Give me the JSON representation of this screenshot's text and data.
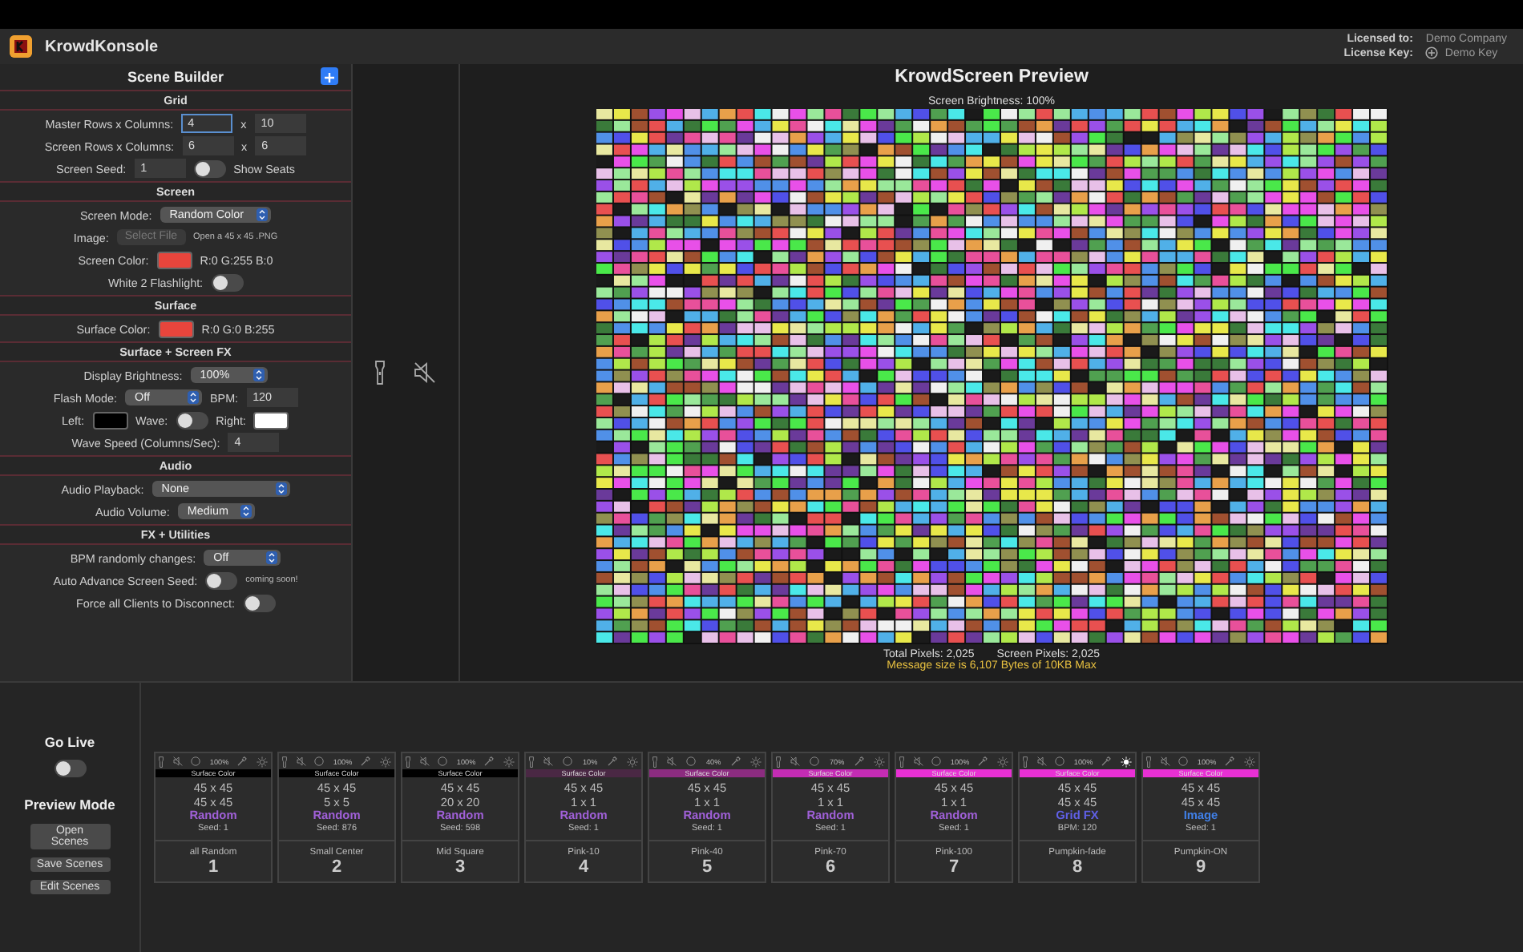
{
  "app": {
    "title": "KrowdKonsole",
    "licensed_label": "Licensed to:",
    "licensed_value": "Demo Company",
    "key_label": "License Key:",
    "key_value": "Demo Key"
  },
  "builder": {
    "title": "Scene Builder",
    "sections": [
      {
        "title": "Grid",
        "rows": [
          {
            "label": "Master Rows x Columns:",
            "items": [
              {
                "kind": "field",
                "value": "4",
                "focused": true
              },
              {
                "kind": "label",
                "text": "x"
              },
              {
                "kind": "field",
                "value": "10",
                "focused": false
              }
            ]
          },
          {
            "label": "Screen Rows x Columns:",
            "items": [
              {
                "kind": "field",
                "value": "6",
                "focused": false
              },
              {
                "kind": "label",
                "text": "x"
              },
              {
                "kind": "field",
                "value": "6",
                "focused": false
              }
            ]
          },
          {
            "label": "Screen Seed:",
            "items": [
              {
                "kind": "field",
                "value": "1",
                "focused": false
              },
              {
                "kind": "toggle",
                "on": false
              },
              {
                "kind": "label",
                "text": "Show Seats"
              }
            ]
          }
        ]
      },
      {
        "title": "Screen",
        "rows": [
          {
            "label": "Screen Mode:",
            "items": [
              {
                "kind": "select",
                "value": "Random Color"
              }
            ]
          },
          {
            "label": "Image:",
            "items": [
              {
                "kind": "button",
                "text": "Select File",
                "disabled": true
              },
              {
                "kind": "note",
                "text": "Open a 45 x 45 .PNG"
              }
            ]
          },
          {
            "label": "Screen Color:",
            "items": [
              {
                "kind": "swatch",
                "color": "#e8453c"
              },
              {
                "kind": "label",
                "text": "R:0 G:255 B:0"
              }
            ]
          },
          {
            "label": "White 2 Flashlight:",
            "items": [
              {
                "kind": "toggle",
                "on": false
              }
            ]
          }
        ]
      },
      {
        "title": "Surface",
        "rows": [
          {
            "label": "Surface Color:",
            "items": [
              {
                "kind": "swatch",
                "color": "#e8453c"
              },
              {
                "kind": "label",
                "text": "R:0 G:0 B:255"
              }
            ]
          }
        ]
      },
      {
        "title": "Surface + Screen FX",
        "rows": [
          {
            "label": "Display Brightness:",
            "items": [
              {
                "kind": "select",
                "value": "100%"
              }
            ]
          },
          {
            "label": "Flash Mode:",
            "items": [
              {
                "kind": "select",
                "value": "Off"
              },
              {
                "kind": "label",
                "text": "BPM:"
              },
              {
                "kind": "field",
                "value": "120",
                "focused": false
              }
            ]
          },
          {
            "label": "Left:",
            "items": [
              {
                "kind": "swatch",
                "color": "#000000"
              },
              {
                "kind": "label",
                "text": "Wave:"
              },
              {
                "kind": "toggle",
                "on": false
              },
              {
                "kind": "label",
                "text": "Right:"
              },
              {
                "kind": "swatch",
                "color": "#ffffff"
              }
            ]
          },
          {
            "label": "Wave Speed (Columns/Sec):",
            "items": [
              {
                "kind": "field",
                "value": "4",
                "focused": false
              }
            ]
          }
        ]
      },
      {
        "title": "Audio",
        "rows": [
          {
            "label": "Audio Playback:",
            "items": [
              {
                "kind": "select",
                "value": "None"
              }
            ]
          },
          {
            "label": "Audio Volume:",
            "items": [
              {
                "kind": "select",
                "value": "Medium"
              }
            ]
          }
        ]
      },
      {
        "title": "FX + Utilities",
        "rows": [
          {
            "label": "BPM randomly changes:",
            "items": [
              {
                "kind": "select",
                "value": "Off"
              }
            ]
          },
          {
            "label": "Auto Advance Screen Seed:",
            "items": [
              {
                "kind": "toggle",
                "on": false
              },
              {
                "kind": "note",
                "text": "coming soon!"
              }
            ]
          },
          {
            "label": "Force all Clients to Disconnect:",
            "items": [
              {
                "kind": "toggle",
                "on": false
              }
            ]
          }
        ]
      }
    ]
  },
  "preview": {
    "title": "KrowdScreen Preview",
    "brightness": "Screen Brightness: 100%",
    "total_pixels": "Total Pixels: 2,025",
    "screen_pixels": "Screen Pixels: 2,025",
    "message": "Message size is 6,107 Bytes of 10KB Max"
  },
  "live": {
    "title": "Go Live",
    "on": false,
    "mode_title": "Preview Mode",
    "buttons": [
      "Open Scenes",
      "Save Scenes",
      "Edit Scenes"
    ]
  },
  "scenes": [
    {
      "brightness": "100%",
      "sun_on": false,
      "surface": {
        "label": "Surface Color",
        "color": "#000000"
      },
      "size_a": "45 x 45",
      "size_b": "45 x 45",
      "mode": {
        "text": "Random",
        "color": "#a060d8"
      },
      "detail": "Seed: 1",
      "name": "all Random",
      "number": "1"
    },
    {
      "brightness": "100%",
      "sun_on": false,
      "surface": {
        "label": "Surface Color",
        "color": "#000000"
      },
      "size_a": "45 x 45",
      "size_b": "5 x 5",
      "mode": {
        "text": "Random",
        "color": "#a060d8"
      },
      "detail": "Seed: 876",
      "name": "Small Center",
      "number": "2"
    },
    {
      "brightness": "100%",
      "sun_on": false,
      "surface": {
        "label": "Surface Color",
        "color": "#000000"
      },
      "size_a": "45 x 45",
      "size_b": "20 x 20",
      "mode": {
        "text": "Random",
        "color": "#a060d8"
      },
      "detail": "Seed: 598",
      "name": "Mid Square",
      "number": "3"
    },
    {
      "brightness": "10%",
      "sun_on": false,
      "surface": {
        "label": "Surface Color",
        "color": "#4a2844"
      },
      "size_a": "45 x 45",
      "size_b": "1 x 1",
      "mode": {
        "text": "Random",
        "color": "#a060d8"
      },
      "detail": "Seed: 1",
      "name": "Pink-10",
      "number": "4"
    },
    {
      "brightness": "40%",
      "sun_on": false,
      "surface": {
        "label": "Surface Color",
        "color": "#8c2c80"
      },
      "size_a": "45 x 45",
      "size_b": "1 x 1",
      "mode": {
        "text": "Random",
        "color": "#a060d8"
      },
      "detail": "Seed: 1",
      "name": "Pink-40",
      "number": "5"
    },
    {
      "brightness": "70%",
      "sun_on": false,
      "surface": {
        "label": "Surface Color",
        "color": "#c42cb4"
      },
      "size_a": "45 x 45",
      "size_b": "1 x 1",
      "mode": {
        "text": "Random",
        "color": "#a060d8"
      },
      "detail": "Seed: 1",
      "name": "Pink-70",
      "number": "6"
    },
    {
      "brightness": "100%",
      "sun_on": false,
      "surface": {
        "label": "Surface Color",
        "color": "#e830d4"
      },
      "size_a": "45 x 45",
      "size_b": "1 x 1",
      "mode": {
        "text": "Random",
        "color": "#a060d8"
      },
      "detail": "Seed: 1",
      "name": "Pink-100",
      "number": "7"
    },
    {
      "brightness": "100%",
      "sun_on": true,
      "surface": {
        "label": "Surface Color",
        "color": "#e830d4"
      },
      "size_a": "45 x 45",
      "size_b": "45 x 45",
      "mode": {
        "text": "Grid FX",
        "color": "#6060e8"
      },
      "detail": "BPM: 120",
      "name": "Pumpkin-fade",
      "number": "8"
    },
    {
      "brightness": "100%",
      "sun_on": false,
      "surface": {
        "label": "Surface Color",
        "color": "#e830d4"
      },
      "size_a": "45 x 45",
      "size_b": "45 x 45",
      "mode": {
        "text": "Image",
        "color": "#4080e8"
      },
      "detail": "Seed: 1",
      "name": "Pumpkin-ON",
      "number": "9"
    }
  ]
}
